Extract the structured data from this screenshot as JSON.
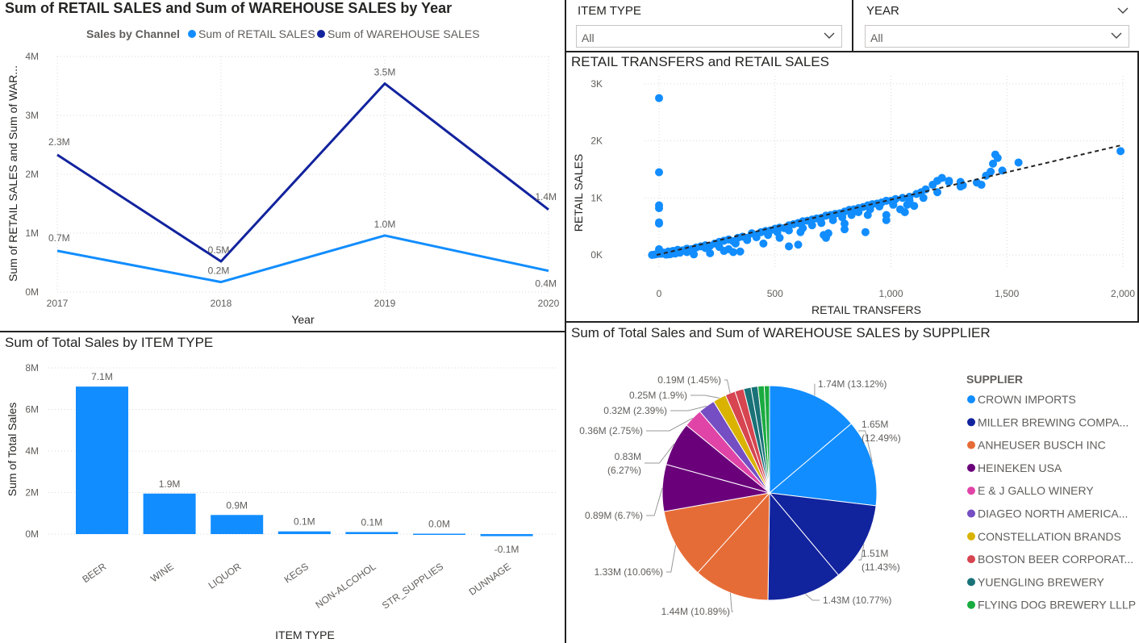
{
  "line_chart": {
    "title": "Sum of RETAIL SALES and Sum of WAREHOUSE SALES by Year",
    "legend_title": "Sales by Channel",
    "ylabel": "Sum of RETAIL SALES and Sum of WAR...",
    "xlabel": "Year"
  },
  "slicer_item_type": {
    "label": "ITEM TYPE",
    "value": "All"
  },
  "slicer_year": {
    "label": "YEAR",
    "value": "All"
  },
  "scatter_chart": {
    "title": "RETAIL TRANSFERS and RETAIL SALES",
    "xlabel": "RETAIL TRANSFERS",
    "ylabel": "RETAIL SALES"
  },
  "bar_chart": {
    "title": "Sum of Total Sales by ITEM TYPE",
    "xlabel": "ITEM TYPE",
    "ylabel": "Sum of Total Sales"
  },
  "pie_chart": {
    "title": "Sum of Total Sales and Sum of WAREHOUSE SALES by SUPPLIER",
    "legend_title": "SUPPLIER"
  },
  "colors": {
    "retail": "#118dff",
    "warehouse": "#12239e",
    "panel_border": "#222222",
    "trend": "#252423"
  },
  "chart_data": [
    {
      "type": "line",
      "title": "Sum of RETAIL SALES and Sum of WAREHOUSE SALES by Year",
      "xlabel": "Year",
      "ylabel": "Sum of RETAIL SALES and Sum of WAR...",
      "x": [
        "2017",
        "2018",
        "2019",
        "2020"
      ],
      "y_ticks": [
        "0M",
        "1M",
        "2M",
        "3M",
        "4M"
      ],
      "ylim": [
        0,
        4000000
      ],
      "grid": true,
      "legend_title": "Sales by Channel",
      "legend_position": "top",
      "series": [
        {
          "name": "Sum of RETAIL SALES",
          "color": "#118dff",
          "values": [
            700000,
            170000,
            960000,
            360000
          ],
          "labels": [
            "0.7M",
            "0.2M",
            "1.0M",
            "0.4M"
          ]
        },
        {
          "name": "Sum of WAREHOUSE SALES",
          "color": "#12239e",
          "values": [
            2330000,
            520000,
            3540000,
            1400000
          ],
          "labels": [
            "2.3M",
            "0.5M",
            "3.5M",
            "1.4M"
          ]
        }
      ]
    },
    {
      "type": "scatter",
      "title": "RETAIL TRANSFERS and RETAIL SALES",
      "xlabel": "RETAIL TRANSFERS",
      "ylabel": "RETAIL SALES",
      "xlim": [
        -60,
        2000
      ],
      "ylim": [
        -200,
        3000
      ],
      "x_ticks": [
        "0",
        "500",
        "1,000",
        "1,500",
        "2,000"
      ],
      "y_ticks": [
        "0K",
        "1K",
        "2K",
        "3K"
      ],
      "trend_line": {
        "from": [
          -10,
          0
        ],
        "to": [
          2000,
          1930
        ]
      },
      "points": [
        [
          0,
          2750
        ],
        [
          0,
          1450
        ],
        [
          0,
          870
        ],
        [
          0,
          820
        ],
        [
          0,
          570
        ],
        [
          0,
          550
        ],
        [
          0,
          100
        ],
        [
          0,
          50
        ],
        [
          0,
          20
        ],
        [
          -30,
          0
        ],
        [
          -20,
          5
        ],
        [
          -10,
          15
        ],
        [
          10,
          20
        ],
        [
          20,
          40
        ],
        [
          40,
          60
        ],
        [
          50,
          30
        ],
        [
          60,
          70
        ],
        [
          80,
          90
        ],
        [
          100,
          80
        ],
        [
          120,
          110
        ],
        [
          140,
          100
        ],
        [
          160,
          130
        ],
        [
          180,
          150
        ],
        [
          200,
          170
        ],
        [
          220,
          160
        ],
        [
          240,
          200
        ],
        [
          260,
          230
        ],
        [
          280,
          250
        ],
        [
          300,
          270
        ],
        [
          320,
          240
        ],
        [
          340,
          300
        ],
        [
          360,
          320
        ],
        [
          380,
          300
        ],
        [
          400,
          380
        ],
        [
          420,
          350
        ],
        [
          440,
          400
        ],
        [
          460,
          420
        ],
        [
          480,
          430
        ],
        [
          500,
          460
        ],
        [
          520,
          480
        ],
        [
          540,
          470
        ],
        [
          560,
          520
        ],
        [
          580,
          540
        ],
        [
          600,
          560
        ],
        [
          620,
          590
        ],
        [
          640,
          600
        ],
        [
          660,
          620
        ],
        [
          680,
          640
        ],
        [
          700,
          650
        ],
        [
          720,
          690
        ],
        [
          740,
          700
        ],
        [
          760,
          720
        ],
        [
          780,
          730
        ],
        [
          800,
          760
        ],
        [
          820,
          790
        ],
        [
          840,
          800
        ],
        [
          860,
          820
        ],
        [
          880,
          840
        ],
        [
          900,
          870
        ],
        [
          920,
          890
        ],
        [
          940,
          900
        ],
        [
          960,
          920
        ],
        [
          980,
          950
        ],
        [
          1000,
          950
        ],
        [
          1020,
          980
        ],
        [
          1050,
          1000
        ],
        [
          1080,
          1020
        ],
        [
          1110,
          1070
        ],
        [
          1130,
          1100
        ],
        [
          1150,
          1150
        ],
        [
          1180,
          1230
        ],
        [
          1200,
          1300
        ],
        [
          1220,
          1350
        ],
        [
          1250,
          1300
        ],
        [
          1300,
          1200
        ],
        [
          1310,
          1220
        ],
        [
          1370,
          1270
        ],
        [
          1390,
          1230
        ],
        [
          1410,
          1390
        ],
        [
          1430,
          1460
        ],
        [
          1440,
          1600
        ],
        [
          1450,
          1760
        ],
        [
          1460,
          1700
        ],
        [
          1480,
          1480
        ],
        [
          1550,
          1620
        ],
        [
          1990,
          1820
        ],
        [
          150,
          10
        ],
        [
          220,
          30
        ],
        [
          300,
          100
        ],
        [
          320,
          50
        ],
        [
          350,
          60
        ],
        [
          280,
          70
        ],
        [
          450,
          200
        ],
        [
          520,
          300
        ],
        [
          560,
          150
        ],
        [
          600,
          180
        ],
        [
          610,
          400
        ],
        [
          710,
          350
        ],
        [
          720,
          300
        ],
        [
          800,
          450
        ],
        [
          730,
          380
        ],
        [
          890,
          400
        ],
        [
          980,
          700
        ],
        [
          1040,
          800
        ],
        [
          1060,
          750
        ],
        [
          1070,
          880
        ],
        [
          1100,
          860
        ],
        [
          980,
          610
        ],
        [
          800,
          550
        ],
        [
          900,
          700
        ],
        [
          1200,
          1100
        ],
        [
          1250,
          1280
        ],
        [
          1300,
          1280
        ],
        [
          120,
          50
        ],
        [
          90,
          40
        ],
        [
          70,
          25
        ],
        [
          40,
          10
        ],
        [
          30,
          5
        ],
        [
          50,
          15
        ],
        [
          200,
          120
        ],
        [
          260,
          140
        ],
        [
          330,
          200
        ],
        [
          380,
          260
        ],
        [
          420,
          310
        ],
        [
          470,
          350
        ],
        [
          510,
          400
        ],
        [
          560,
          430
        ],
        [
          620,
          470
        ],
        [
          660,
          520
        ],
        [
          700,
          560
        ],
        [
          750,
          610
        ],
        [
          790,
          660
        ],
        [
          830,
          700
        ],
        [
          860,
          750
        ],
        [
          910,
          800
        ],
        [
          950,
          850
        ],
        [
          1010,
          880
        ],
        [
          1080,
          950
        ],
        [
          1140,
          1000
        ]
      ]
    },
    {
      "type": "bar",
      "title": "Sum of Total Sales by ITEM TYPE",
      "xlabel": "ITEM TYPE",
      "ylabel": "Sum of Total Sales",
      "categories": [
        "BEER",
        "WINE",
        "LIQUOR",
        "KEGS",
        "NON-ALCOHOL",
        "STR_SUPPLIES",
        "DUNNAGE"
      ],
      "values": [
        7100000,
        1950000,
        920000,
        130000,
        100000,
        20000,
        -100000
      ],
      "labels": [
        "7.1M",
        "1.9M",
        "0.9M",
        "0.1M",
        "0.1M",
        "0.0M",
        "-0.1M"
      ],
      "y_ticks": [
        "0M",
        "2M",
        "4M",
        "6M",
        "8M"
      ],
      "ylim": [
        -100000,
        8000000
      ],
      "color": "#118dff"
    },
    {
      "type": "pie",
      "title": "Sum of Total Sales and Sum of WAREHOUSE SALES by SUPPLIER",
      "legend_title": "SUPPLIER",
      "legend_position": "right",
      "slices": [
        {
          "name": "CROWN IMPORTS",
          "value": 1.74,
          "pct": 13.12,
          "label": "1.74M (13.12%)",
          "color": "#118dff"
        },
        {
          "name": "",
          "value": 1.65,
          "pct": 12.49,
          "label": "1.65M (12.49%)",
          "color": "#118dff"
        },
        {
          "name": "MILLER BREWING COMPA...",
          "value": 1.51,
          "pct": 11.43,
          "label": "1.51M (11.43%)",
          "color": "#12239e"
        },
        {
          "name": "",
          "value": 1.43,
          "pct": 10.77,
          "label": "1.43M (10.77%)",
          "color": "#12239e"
        },
        {
          "name": "ANHEUSER BUSCH INC",
          "value": 1.44,
          "pct": 10.89,
          "label": "1.44M (10.89%)",
          "color": "#e66c37"
        },
        {
          "name": "",
          "value": 1.33,
          "pct": 10.06,
          "label": "1.33M (10.06%)",
          "color": "#e66c37"
        },
        {
          "name": "HEINEKEN USA",
          "value": 0.89,
          "pct": 6.7,
          "label": "0.89M (6.7%)",
          "color": "#6b007b"
        },
        {
          "name": "",
          "value": 0.83,
          "pct": 6.27,
          "label": "0.83M (6.27%)",
          "color": "#6b007b"
        },
        {
          "name": "E & J GALLO WINERY",
          "value": 0.36,
          "pct": 2.75,
          "label": "0.36M (2.75%)",
          "color": "#e044a7"
        },
        {
          "name": "DIAGEO NORTH AMERICA...",
          "value": 0.32,
          "pct": 2.39,
          "label": "0.32M (2.39%)",
          "color": "#744ec2"
        },
        {
          "name": "CONSTELLATION BRANDS",
          "value": 0.25,
          "pct": 1.9,
          "label": "0.25M (1.9%)",
          "color": "#d9b300"
        },
        {
          "name": "BOSTON BEER CORPORAT...",
          "value": 0.19,
          "pct": 1.45,
          "label": "0.19M (1.45%)",
          "color": "#d64550"
        },
        {
          "name": "",
          "value": 0.17,
          "pct": 1.3,
          "label": "",
          "color": "#d64550"
        },
        {
          "name": "YUENGLING BREWERY",
          "value": 0.14,
          "pct": 1.1,
          "label": "",
          "color": "#197278"
        },
        {
          "name": "",
          "value": 0.13,
          "pct": 1.0,
          "label": "",
          "color": "#197278"
        },
        {
          "name": "FLYING DOG BREWERY LLLP",
          "value": 0.12,
          "pct": 0.9,
          "label": "",
          "color": "#1aab40"
        },
        {
          "name": "",
          "value": 0.1,
          "pct": 0.8,
          "label": "",
          "color": "#1aab40"
        }
      ],
      "legend": [
        {
          "name": "CROWN IMPORTS",
          "color": "#118dff"
        },
        {
          "name": "MILLER BREWING COMPA...",
          "color": "#12239e"
        },
        {
          "name": "ANHEUSER BUSCH INC",
          "color": "#e66c37"
        },
        {
          "name": "HEINEKEN USA",
          "color": "#6b007b"
        },
        {
          "name": "E & J GALLO WINERY",
          "color": "#e044a7"
        },
        {
          "name": "DIAGEO NORTH AMERICA...",
          "color": "#744ec2"
        },
        {
          "name": "CONSTELLATION BRANDS",
          "color": "#d9b300"
        },
        {
          "name": "BOSTON BEER CORPORAT...",
          "color": "#d64550"
        },
        {
          "name": "YUENGLING BREWERY",
          "color": "#197278"
        },
        {
          "name": "FLYING DOG BREWERY LLLP",
          "color": "#1aab40"
        }
      ]
    }
  ]
}
